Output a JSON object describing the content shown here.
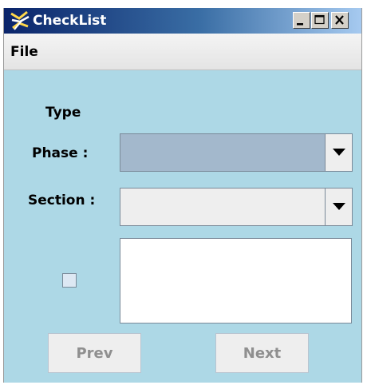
{
  "window": {
    "title": "CheckList",
    "icon": "checklist-app-icon",
    "controls": [
      "minimize-icon",
      "maximize-icon",
      "close-icon"
    ]
  },
  "menubar": {
    "items": [
      {
        "label": "File"
      }
    ]
  },
  "form": {
    "type_label": "Type",
    "phase_label": "Phase :",
    "phase_value": "",
    "section_label": "Section :",
    "section_value": "",
    "item_checked": false,
    "item_text": ""
  },
  "navigation": {
    "prev_label": "Prev",
    "next_label": "Next",
    "prev_enabled": false,
    "next_enabled": false
  },
  "colors": {
    "panel_background": "#add8e6",
    "phase_combo_background": "#a3b8cc",
    "titlebar_start": "#0a246a",
    "titlebar_end": "#a6caf0"
  }
}
